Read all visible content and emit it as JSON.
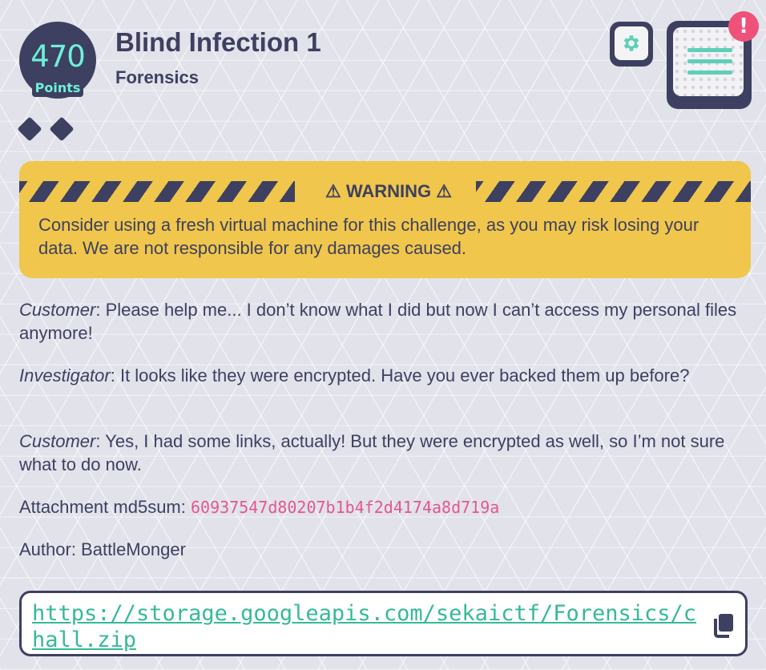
{
  "challenge": {
    "points_value": "470",
    "points_label": "Points",
    "title": "Blind Infection 1",
    "category": "Forensics",
    "difficulty_icons": [
      "diamond-icon",
      "diamond-icon"
    ]
  },
  "toolbar": {
    "settings_icon": "gear-icon",
    "menu_icon": "list-icon",
    "alert_badge": "!"
  },
  "warning": {
    "title": "⚠ WARNING ⚠",
    "text": "Consider using a fresh virtual machine for this challenge, as you may risk losing your data. We are not responsible for any damages caused."
  },
  "description": [
    {
      "speaker": "Customer",
      "text": ": Please help me... I don’t know what I did but now I can’t access my personal files anymore!"
    },
    {
      "speaker": "Investigator",
      "text": ": It looks like they were encrypted. Have you ever backed them up before?"
    },
    {
      "speaker": "Customer",
      "text": ": Yes, I had some links, actually! But they were encrypted as well, so I’m not sure what to do now."
    }
  ],
  "attachment": {
    "label": "Attachment md5sum: ",
    "md5": "60937547d80207b1b4f2d4174a8d719a"
  },
  "author": "Author: BattleMonger",
  "download": {
    "url": "https://storage.googleapis.com/sekaictf/Forensics/chall.zip",
    "copy_icon": "copy-icon"
  },
  "colors": {
    "navy": "#3d4060",
    "teal": "#6ef0d8",
    "link_green": "#36b99a",
    "warning_yellow": "#f0c64c",
    "hash_pink": "#e2588c",
    "alert_pink": "#f0517a"
  }
}
